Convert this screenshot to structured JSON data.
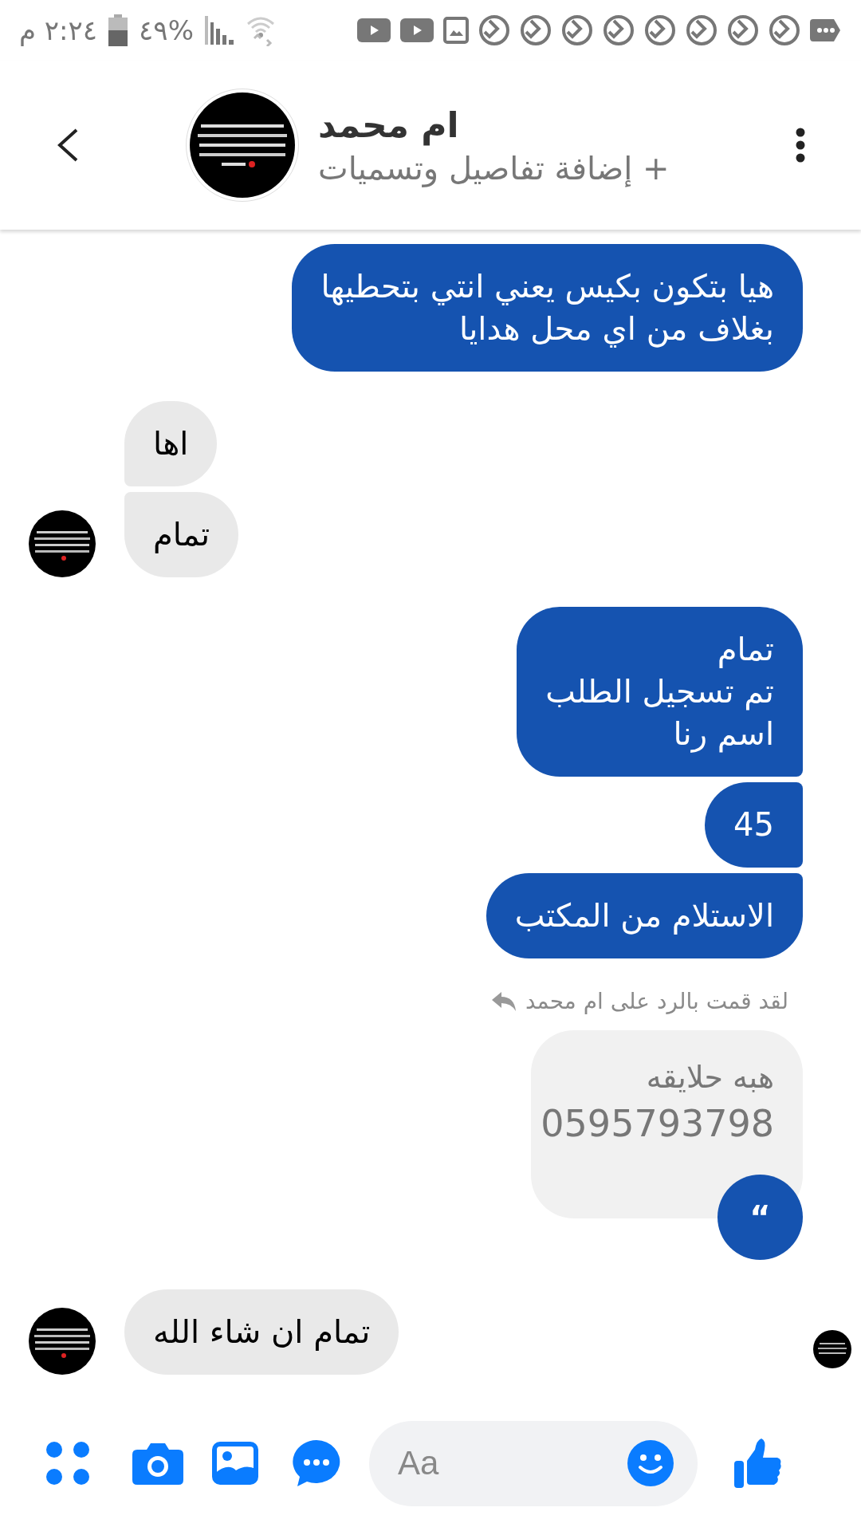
{
  "status_bar": {
    "time": "٢:٢٤ م",
    "battery": "%٤٩"
  },
  "header": {
    "name": "ام محمد",
    "subtitle": "+ إضافة تفاصيل وتسميات"
  },
  "messages": [
    {
      "kind": "outgoing",
      "lines": [
        "هيا بتكون بكيس يعني انتي بتحطيها",
        "بغلاف من اي محل هدايا"
      ]
    },
    {
      "kind": "incoming",
      "lines": [
        "اها"
      ],
      "avatar": false
    },
    {
      "kind": "incoming",
      "lines": [
        "تمام"
      ],
      "avatar": true
    },
    {
      "kind": "outgoing",
      "lines": [
        "تمام",
        "تم تسجيل الطلب",
        "اسم رنا"
      ]
    },
    {
      "kind": "outgoing",
      "lines": [
        "45"
      ]
    },
    {
      "kind": "outgoing",
      "lines": [
        "الاستلام من المكتب"
      ]
    },
    {
      "kind": "reply",
      "note": "لقد قمت بالرد على ام محمد",
      "lines": [
        "هبه حلايقه",
        "0595793798"
      ],
      "quote": "“"
    },
    {
      "kind": "incoming",
      "lines": [
        "تمام ان شاء الله"
      ],
      "avatar": true,
      "seen": true
    }
  ],
  "composer": {
    "placeholder": "Aa"
  }
}
